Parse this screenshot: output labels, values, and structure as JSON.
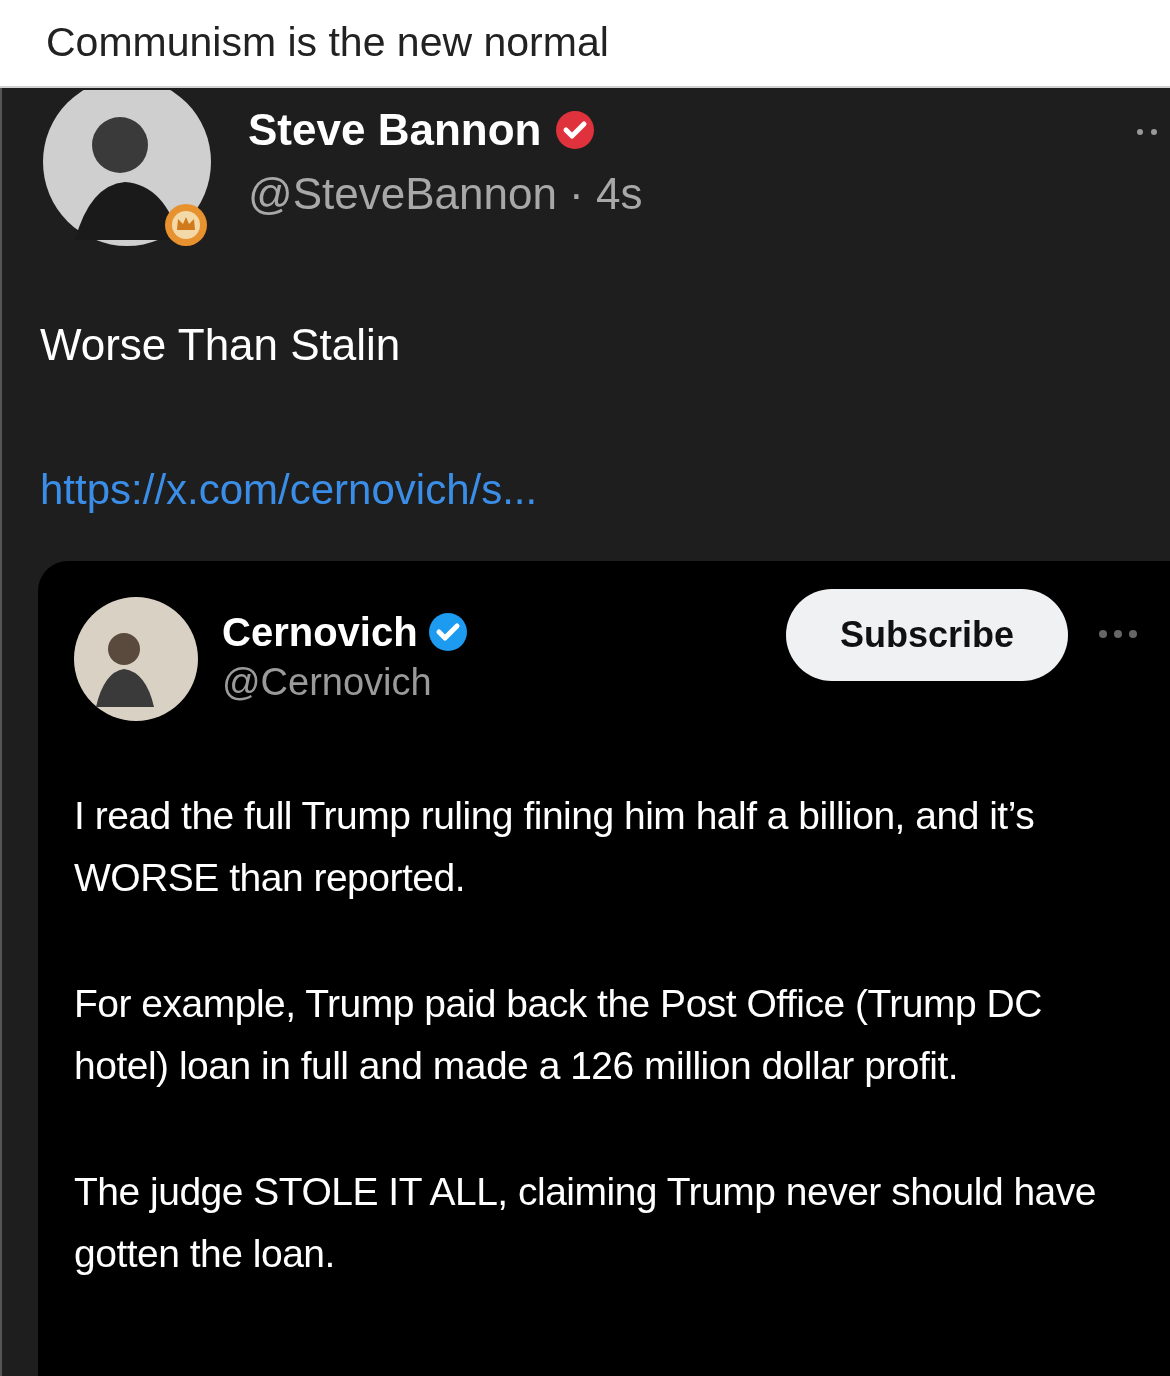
{
  "caption": "Communism is the new normal",
  "post": {
    "author": "Steve Bannon",
    "verified": true,
    "handle": "@SteveBannon · 4s",
    "text": "Worse Than Stalin",
    "link": "https://x.com/cernovich/s...",
    "quote": {
      "author": "Cernovich",
      "verified": true,
      "handle": "@Cernovich",
      "button": "Subscribe",
      "paragraphs": [
        "I read the full Trump ruling fining him half a billion, and it’s WORSE than reported.",
        "For example, Trump paid back the Post Office (Trump DC hotel) loan in full and made a 126 million dollar profit.",
        "The judge STOLE IT ALL, claiming Trump never should have gotten the loan."
      ]
    }
  }
}
